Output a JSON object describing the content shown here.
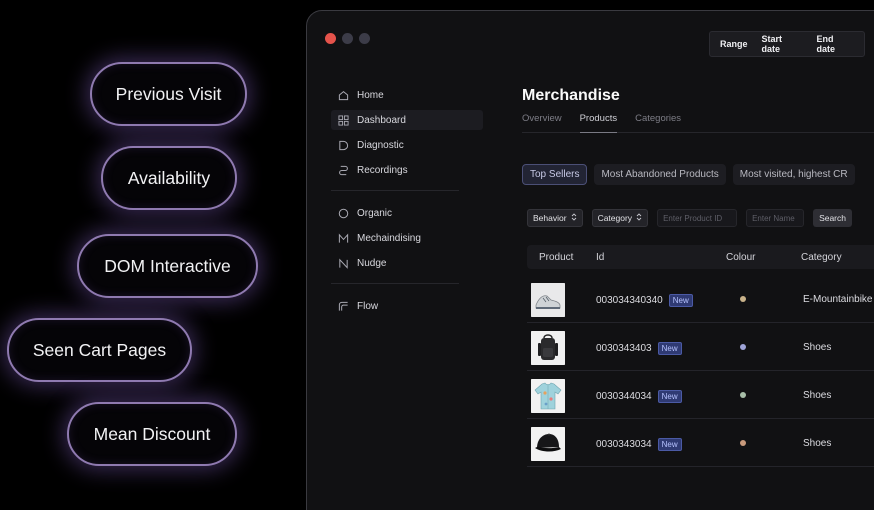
{
  "pills": [
    "Previous Visit",
    "Availability",
    "DOM Interactive",
    "Seen Cart Pages",
    "Mean Discount"
  ],
  "range_bar": {
    "range": "Range",
    "start": "Start date",
    "end": "End date"
  },
  "sidebar": {
    "items": [
      {
        "label": "Home",
        "icon": "home-icon"
      },
      {
        "label": "Dashboard",
        "icon": "grid-icon",
        "active": true
      },
      {
        "label": "Diagnostic",
        "icon": "diagnostic-icon"
      },
      {
        "label": "Recordings",
        "icon": "recordings-icon"
      },
      {
        "label": "Organic",
        "icon": "circle-icon"
      },
      {
        "label": "Mechaindising",
        "icon": "m-icon"
      },
      {
        "label": "Nudge",
        "icon": "n-icon"
      },
      {
        "label": "Flow",
        "icon": "flow-icon"
      }
    ]
  },
  "main": {
    "title": "Merchandise",
    "tabs": [
      "Overview",
      "Products",
      "Categories"
    ],
    "active_tab": "Products",
    "chips": [
      "Top Sellers",
      "Most Abandoned Products",
      "Most visited, highest CR"
    ],
    "filters": {
      "behavior": "Behavior",
      "category": "Category",
      "product_id_placeholder": "Enter Product ID",
      "name_placeholder": "Enter Name",
      "search": "Search"
    },
    "table": {
      "headers": [
        "Product",
        "Id",
        "Colour",
        "Category"
      ],
      "rows": [
        {
          "id": "003034340340",
          "badge": "New",
          "colour": "#c9b28a",
          "category": "E-Mountainbike"
        },
        {
          "id": "0030343403",
          "badge": "New",
          "colour": "#9fa4d8",
          "category": "Shoes"
        },
        {
          "id": "0030344034",
          "badge": "New",
          "colour": "#a9bfa9",
          "category": "Shoes"
        },
        {
          "id": "0030343034",
          "badge": "New",
          "colour": "#c99a7c",
          "category": "Shoes"
        }
      ]
    }
  },
  "colors": {
    "pill_border": "#8f7ab0",
    "accent_badge": "#2f3a73",
    "close_dot": "#e5534b"
  }
}
